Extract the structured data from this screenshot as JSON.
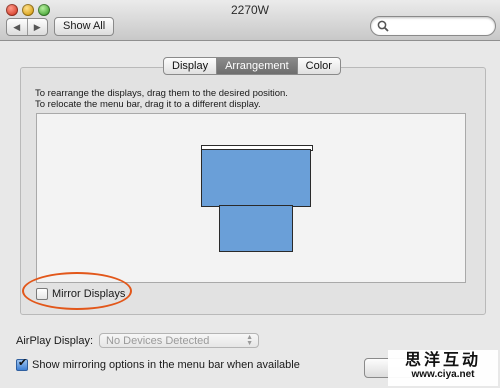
{
  "window": {
    "title": "2270W"
  },
  "toolbar": {
    "back_icon": "chevron-left-icon",
    "forward_icon": "chevron-right-icon",
    "show_all_label": "Show All",
    "search_placeholder": ""
  },
  "tabs": [
    {
      "label": "Display",
      "selected": false
    },
    {
      "label": "Arrangement",
      "selected": true
    },
    {
      "label": "Color",
      "selected": false
    }
  ],
  "arrangement": {
    "instruction_line1": "To rearrange the displays, drag them to the desired position.",
    "instruction_line2": "To relocate the menu bar, drag it to a different display.",
    "display_color": "#6a9fd8",
    "mirror_displays_label": "Mirror Displays",
    "mirror_displays_checked": false,
    "annotation_color": "#e2571a"
  },
  "airplay": {
    "label": "AirPlay Display:",
    "selected_value": "No Devices Detected"
  },
  "show_mirroring": {
    "label": "Show mirroring options in the menu bar when available",
    "checked": true
  },
  "watermark": {
    "title": "思洋互动",
    "url": "www.ciya.net"
  }
}
